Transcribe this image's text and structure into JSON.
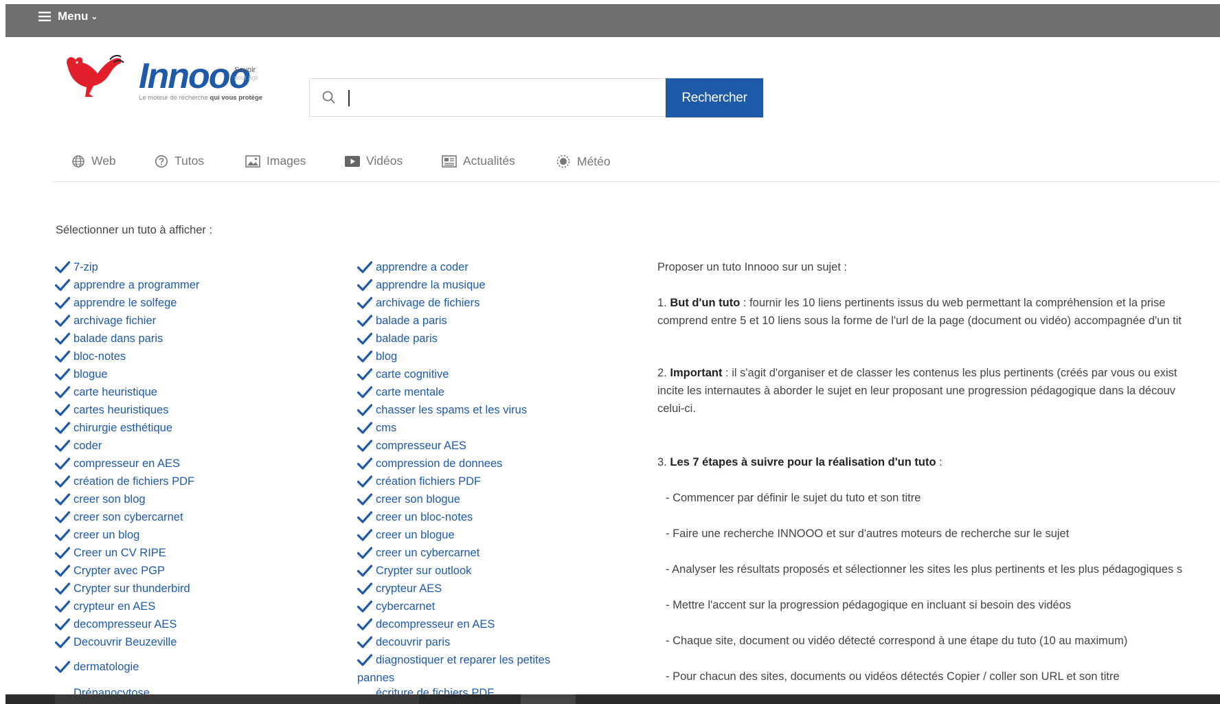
{
  "header": {
    "menu_label": "Menu"
  },
  "logo": {
    "word": "Innooo",
    "savoir": "Savoir",
    "savoir_sub": "pour agir",
    "tagline_start": "Le moteur de recherche ",
    "tagline_bold": "qui vous protège"
  },
  "search": {
    "value": "",
    "button_label": "Rechercher",
    "icon": "search-icon"
  },
  "tabs": [
    {
      "label": "Web",
      "icon": "globe-icon"
    },
    {
      "label": "Tutos",
      "icon": "question-icon"
    },
    {
      "label": "Images",
      "icon": "image-icon"
    },
    {
      "label": "Vidéos",
      "icon": "video-icon"
    },
    {
      "label": "Actualités",
      "icon": "news-icon"
    },
    {
      "label": "Météo",
      "icon": "weather-icon"
    }
  ],
  "select_label": "Sélectionner un tuto à afficher :",
  "column1": [
    "7-zip",
    "apprendre a programmer",
    "apprendre le solfege",
    "archivage fichier",
    "balade dans paris",
    "bloc-notes",
    "blogue",
    "carte heuristique",
    "cartes heuristiques",
    "chirurgie esthétique",
    "coder",
    "compresseur en AES",
    "création de fichiers PDF",
    "creer son blog",
    "creer son cybercarnet",
    "creer un blog",
    "Creer un CV RIPE",
    "Crypter avec PGP",
    "Crypter sur thunderbird",
    "crypteur en AES",
    "decompresseur AES",
    "Decouvrir Beuzeville",
    "dermatologie"
  ],
  "column1_cut": "Drépanocytose",
  "column2": [
    "apprendre a coder",
    "apprendre la musique",
    "archivage de fichiers",
    "balade a paris",
    "balade paris",
    "blog",
    "carte cognitive",
    "carte mentale",
    "chasser les spams et les virus",
    "cms",
    "compresseur AES",
    "compression de donnees",
    "création fichiers PDF",
    "creer son blogue",
    "creer un bloc-notes",
    "creer un blogue",
    "creer un cybercarnet",
    "Crypter sur outlook",
    "crypteur AES",
    "cybercarnet",
    "decompresseur en AES",
    "decouvrir paris"
  ],
  "column2_wrap_a": "diagnostiquer et reparer les petites",
  "column2_wrap_b": "pannes",
  "column2_cut": "écriture de fichiers PDF",
  "info": {
    "intro": "Proposer un tuto Innooo sur un sujet :",
    "p1_num": "1. ",
    "p1_bold": "But d'un tuto",
    "p1_line1": " : fournir les 10 liens pertinents issus du web permettant la compréhension et la prise",
    "p1_line2": "comprend entre 5 et 10 liens sous la forme de l'url de la page (document ou vidéo) accompagnée d'un tit",
    "p2_num": "2. ",
    "p2_bold": "Important",
    "p2_line1": " : il s'agit d'organiser et de classer les contenus les plus pertinents (créés par vous ou exist",
    "p2_line2": "incite les internautes à aborder le sujet en leur proposant une progression pédagogique dans la découv",
    "p2_line3": "celui-ci.",
    "p3_num": "3. ",
    "p3_bold": "Les 7 étapes à suivre pour la réalisation d'un tuto",
    "p3_end": " :",
    "steps": [
      "- Commencer par définir le sujet du tuto et son titre",
      "- Faire une recherche INNOOO et sur d'autres moteurs de recherche sur le sujet",
      "- Analyser les résultats proposés et sélectionner les sites les plus pertinents et les plus pédagogiques s",
      "- Mettre l'accent sur la progression pédagogique en incluant si besoin des vidéos",
      "- Chaque site, document ou vidéo détecté correspond à une étape du tuto (10 au maximum)",
      "- Pour chacun des sites, documents ou vidéos détectés Copier / coller son URL et son titre"
    ]
  },
  "colors": {
    "brand_blue": "#1f5aa8",
    "topbar": "#6f6f6f",
    "rooster_red": "#e2202b"
  }
}
